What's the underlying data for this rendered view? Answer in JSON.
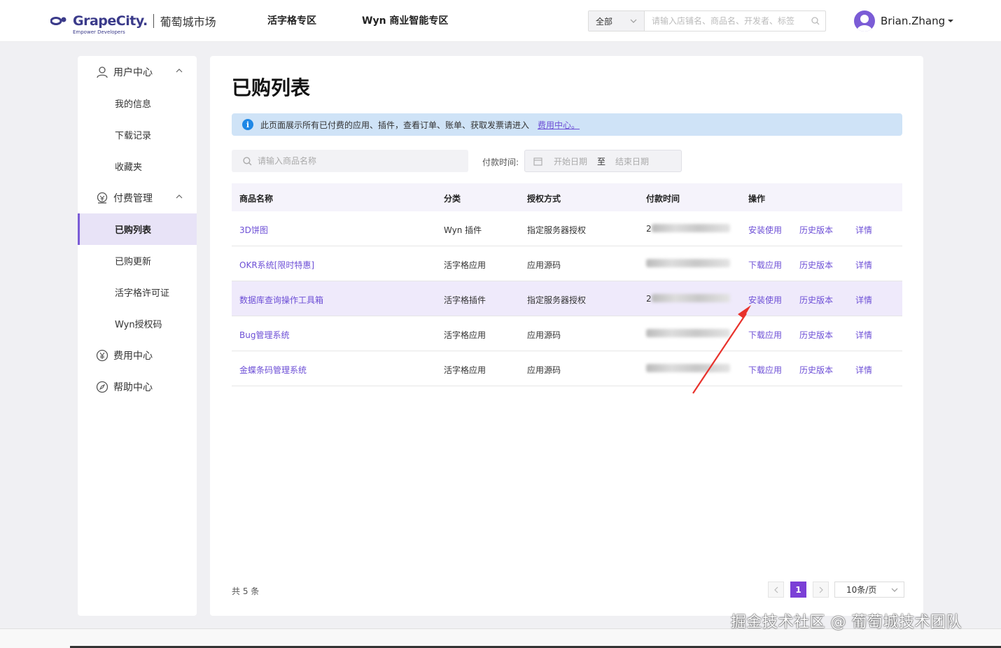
{
  "header": {
    "logo_brand": "GrapeCity.",
    "logo_tagline": "Empower Developers",
    "market_name": "葡萄城市场",
    "nav": [
      "活字格专区",
      "Wyn 商业智能专区"
    ],
    "search_scope": "全部",
    "search_placeholder": "请输入店铺名、商品名、开发者、标签",
    "username": "Brian.Zhang"
  },
  "sidebar": {
    "groups": [
      {
        "label": "用户中心",
        "icon": "user-icon",
        "expanded": true
      },
      {
        "label": "付费管理",
        "icon": "payment-icon",
        "expanded": true
      },
      {
        "label": "费用中心",
        "icon": "yen-icon"
      },
      {
        "label": "帮助中心",
        "icon": "compass-icon"
      }
    ],
    "items": [
      "我的信息",
      "下载记录",
      "收藏夹",
      "已购列表",
      "已购更新",
      "活字格许可证",
      "Wyn授权码"
    ],
    "active_item": "已购列表"
  },
  "main": {
    "title": "已购列表",
    "info_text": "此页面展示所有已付费的应用、插件，查看订单、账单、获取发票请进入",
    "info_link": "费用中心。",
    "filter_placeholder": "请输入商品名称",
    "date_label": "付款时间:",
    "date_start": "开始日期",
    "date_sep": "至",
    "date_end": "结束日期"
  },
  "table": {
    "headers": [
      "商品名称",
      "分类",
      "授权方式",
      "付款时间",
      "操作"
    ],
    "rows": [
      {
        "name": "3D饼图",
        "category": "Wyn 插件",
        "license": "指定服务器授权",
        "time_prefix": "2",
        "op1": "安装使用",
        "op2": "历史版本",
        "op3": "详情",
        "highlight": false
      },
      {
        "name": "OKR系统[限时特惠]",
        "category": "活字格应用",
        "license": "应用源码",
        "time_prefix": "",
        "op1": "下载应用",
        "op2": "历史版本",
        "op3": "详情",
        "highlight": false
      },
      {
        "name": "数据库查询操作工具箱",
        "category": "活字格插件",
        "license": "指定服务器授权",
        "time_prefix": "2",
        "op1": "安装使用",
        "op2": "历史版本",
        "op3": "详情",
        "highlight": true
      },
      {
        "name": "Bug管理系统",
        "category": "活字格应用",
        "license": "应用源码",
        "time_prefix": "",
        "op1": "下载应用",
        "op2": "历史版本",
        "op3": "详情",
        "highlight": false
      },
      {
        "name": "金蝶条码管理系统",
        "category": "活字格应用",
        "license": "应用源码",
        "time_prefix": "",
        "op1": "下载应用",
        "op2": "历史版本",
        "op3": "详情",
        "highlight": false
      }
    ]
  },
  "pagination": {
    "total": "共 5 条",
    "current_page": "1",
    "page_size": "10条/页"
  },
  "watermark": "掘金技术社区 @ 葡萄城技术团队",
  "colors": {
    "accent": "#7b3fd6",
    "link": "#6d4fd6",
    "info_bg": "#cfe3f7",
    "annotation": "#e8322c"
  }
}
